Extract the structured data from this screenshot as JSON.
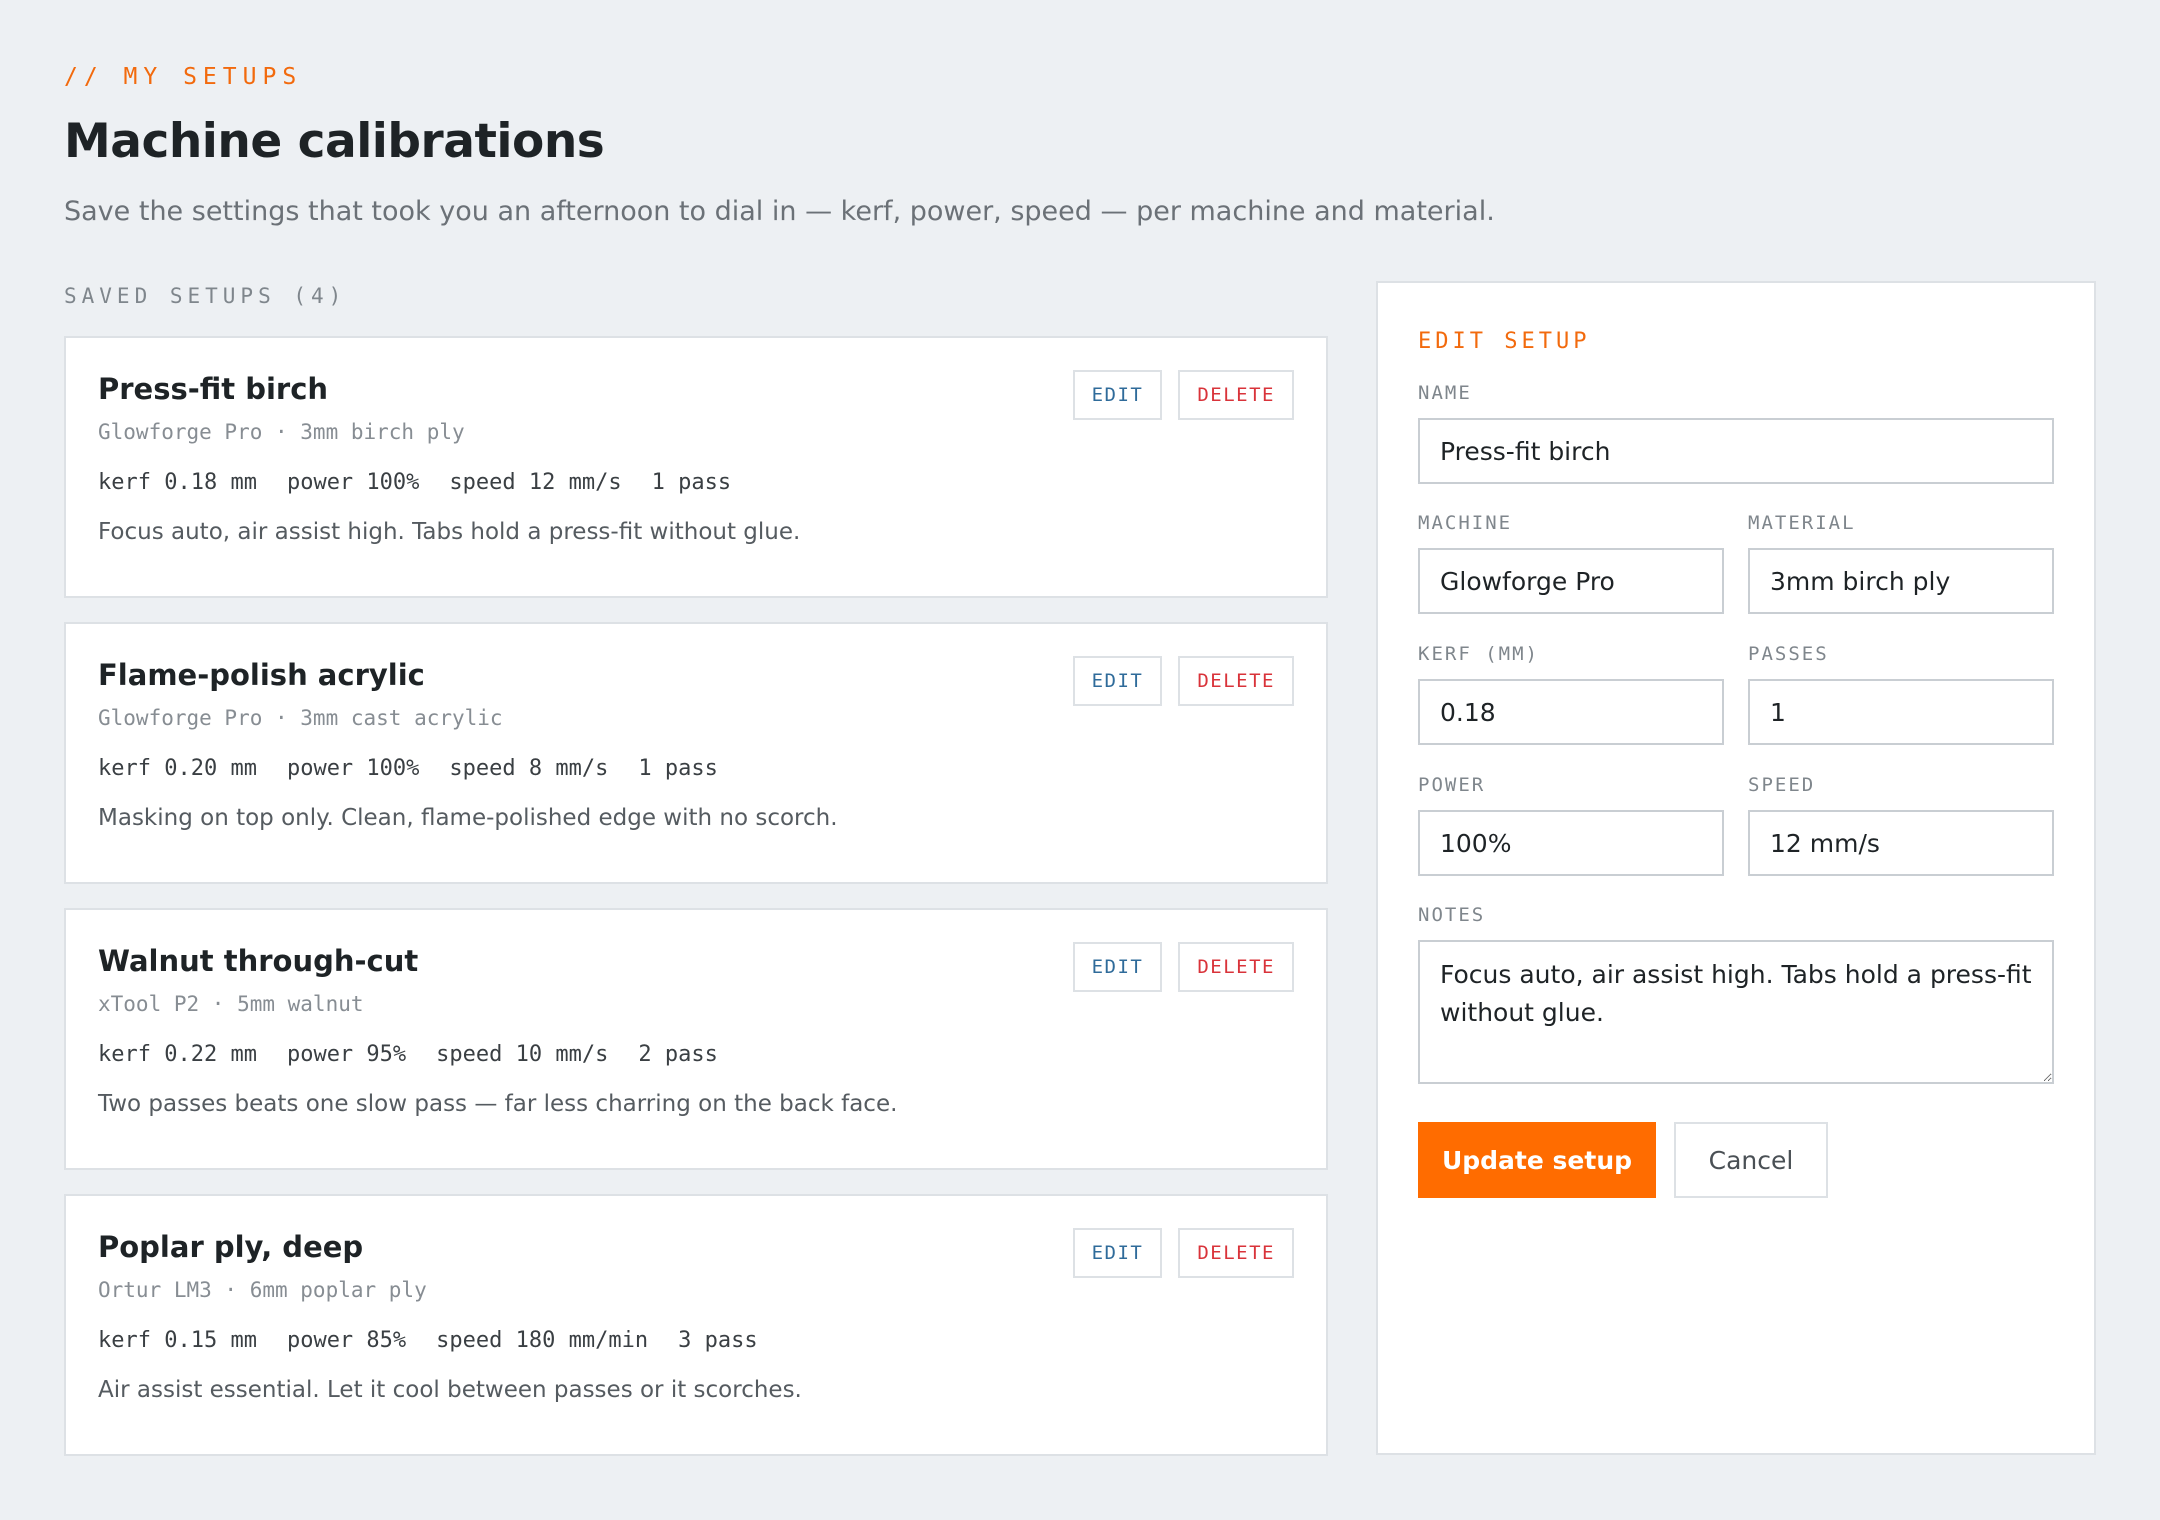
{
  "header": {
    "eyebrow": "// MY SETUPS",
    "title": "Machine calibrations",
    "subtitle": "Save the settings that took you an afternoon to dial in — kerf, power, speed — per machine and material."
  },
  "list": {
    "section_label": "SAVED SETUPS (4)",
    "edit_label": "EDIT",
    "delete_label": "DELETE",
    "setups": [
      {
        "name": "Press-fit birch",
        "meta": "Glowforge Pro · 3mm birch ply",
        "kerf": "kerf 0.18 mm",
        "power": "power 100%",
        "speed": "speed 12 mm/s",
        "passes": "1 pass",
        "notes": "Focus auto, air assist high. Tabs hold a press-fit without glue."
      },
      {
        "name": "Flame-polish acrylic",
        "meta": "Glowforge Pro · 3mm cast acrylic",
        "kerf": "kerf 0.20 mm",
        "power": "power 100%",
        "speed": "speed 8 mm/s",
        "passes": "1 pass",
        "notes": "Masking on top only. Clean, flame-polished edge with no scorch."
      },
      {
        "name": "Walnut through-cut",
        "meta": "xTool P2 · 5mm walnut",
        "kerf": "kerf 0.22 mm",
        "power": "power 95%",
        "speed": "speed 10 mm/s",
        "passes": "2 pass",
        "notes": "Two passes beats one slow pass — far less charring on the back face."
      },
      {
        "name": "Poplar ply, deep",
        "meta": "Ortur LM3 · 6mm poplar ply",
        "kerf": "kerf 0.15 mm",
        "power": "power 85%",
        "speed": "speed 180 mm/min",
        "passes": "3 pass",
        "notes": "Air assist essential. Let it cool between passes or it scorches."
      }
    ]
  },
  "form": {
    "title": "EDIT SETUP",
    "name_label": "NAME",
    "name_value": "Press-fit birch",
    "machine_label": "MACHINE",
    "machine_value": "Glowforge Pro",
    "material_label": "MATERIAL",
    "material_value": "3mm birch ply",
    "kerf_label": "KERF (MM)",
    "kerf_value": "0.18",
    "passes_label": "PASSES",
    "passes_value": "1",
    "power_label": "POWER",
    "power_value": "100%",
    "speed_label": "SPEED",
    "speed_value": "12 mm/s",
    "notes_label": "NOTES",
    "notes_value": "Focus auto, air assist high. Tabs hold a press-fit without glue.",
    "submit_label": "Update setup",
    "cancel_label": "Cancel"
  },
  "colors": {
    "accent": "#ff6c00",
    "edit": "#2f6b9a",
    "delete": "#d9333a",
    "background": "#edf0f3"
  }
}
